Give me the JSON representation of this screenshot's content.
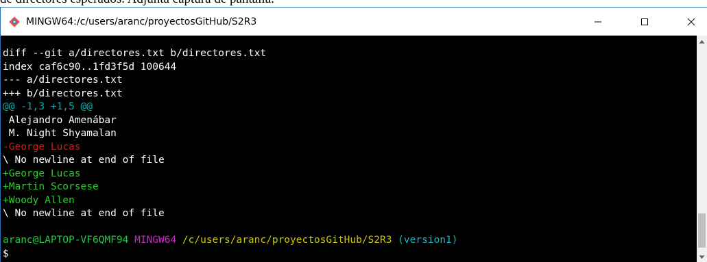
{
  "document": {
    "caption": "de directores esperados. Adjunta captura de pantalla."
  },
  "window": {
    "title": "MINGW64:/c/users/aranc/proyectosGitHub/S2R3",
    "icon": "git-bash-icon",
    "controls": {
      "minimize": "minimize-icon",
      "maximize": "maximize-icon",
      "close": "close-icon"
    }
  },
  "colors": {
    "background": "#000000",
    "text": "#ffffff",
    "hunk": "#00b4b4",
    "removed": "#c81e1e",
    "added": "#2ccc2c",
    "prompt_user": "#23c843",
    "prompt_shell": "#c42ec4",
    "prompt_path": "#c8c800",
    "prompt_branch": "#19b4c8"
  },
  "terminal": {
    "diff_header": "diff --git a/directores.txt b/directores.txt",
    "index_line": "index caf6c90..1fd3f5d 100644",
    "old_file": "--- a/directores.txt",
    "new_file": "+++ b/directores.txt",
    "hunk_header": "@@ -1,3 +1,5 @@",
    "context_1": " Alejandro Amenábar",
    "context_2": " M. Night Shyamalan",
    "removed_1": "-George Lucas",
    "no_newline_1": "\\ No newline at end of file",
    "added_1": "+George Lucas",
    "added_2": "+Martin Scorsese",
    "added_3": "+Woody Allen",
    "no_newline_2": "\\ No newline at end of file",
    "prompt": {
      "user_host": "aranc@LAPTOP-VF6QMF94",
      "shell": "MINGW64",
      "path": "/c/users/aranc/proyectosGitHub/S2R3",
      "branch": "(version1)",
      "symbol": "$"
    }
  }
}
